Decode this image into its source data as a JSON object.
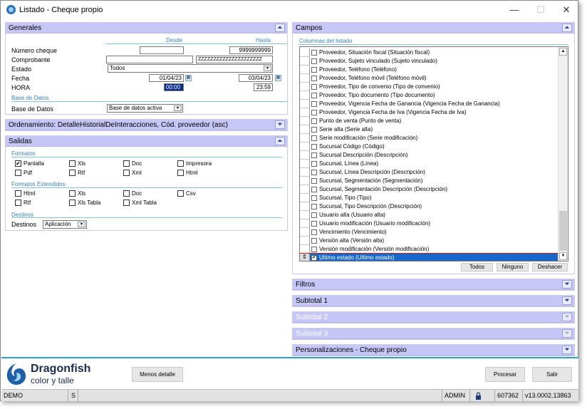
{
  "window": {
    "title": "Listado - Cheque propio",
    "minimize": "—",
    "maximize": "☐",
    "close": "✕"
  },
  "generales": {
    "title": "Generales",
    "desde": "Desde",
    "hasta": "Hasta",
    "numero_cheque_label": "Número cheque",
    "numero_cheque_desde": "",
    "numero_cheque_hasta": "9999999999",
    "comprobante_label": "Comprobante",
    "comprobante_desde": "",
    "comprobante_hasta": "ZZZZZZZZZZZZZZZZZZZZZ",
    "estado_label": "Estado",
    "estado_value": "Todos",
    "fecha_label": "Fecha",
    "fecha_desde": "01/04/23",
    "fecha_hasta": "03/04/23",
    "hora_label": "HORA",
    "hora_desde": "00:00",
    "hora_hasta": "23:59",
    "base_datos_section": "Base de Datos",
    "base_datos_label": "Base de Datos",
    "base_datos_value": "Base de datos activa"
  },
  "ordenamiento": {
    "title": "Ordenamiento: DetalleHistorialDeInteracciones, Cód. proveedor (asc)"
  },
  "salidas": {
    "title": "Salidas",
    "formatos_section": "Formatos",
    "formatos": [
      {
        "label": "Pantalla",
        "checked": true
      },
      {
        "label": "Xls",
        "checked": false
      },
      {
        "label": "Doc",
        "checked": false
      },
      {
        "label": "Impresora",
        "checked": false
      },
      {
        "label": "Pdf",
        "checked": false
      },
      {
        "label": "Rtf",
        "checked": false
      },
      {
        "label": "Xml",
        "checked": false
      },
      {
        "label": "Html",
        "checked": false
      }
    ],
    "extendidos_section": "Formatos Extendidos",
    "extendidos": [
      {
        "label": "Html",
        "checked": false
      },
      {
        "label": "Xls",
        "checked": false
      },
      {
        "label": "Doc",
        "checked": false
      },
      {
        "label": "Csv",
        "checked": false
      },
      {
        "label": "Rtf",
        "checked": false
      },
      {
        "label": "Xls Tabla",
        "checked": false
      },
      {
        "label": "Xml Tabla",
        "checked": false
      }
    ],
    "destinos_section": "Destinos",
    "destinos_label": "Destinos",
    "destinos_value": "Aplicación"
  },
  "campos": {
    "title": "Campos",
    "columnas_label": "Columnas del listado",
    "items": [
      {
        "label": "Proveedor, Situación fiscal (Situación fiscal)",
        "checked": false
      },
      {
        "label": "Proveedor, Sujeto vinculado (Sujeto vinculado)",
        "checked": false
      },
      {
        "label": "Proveedor, Teléfono (Teléfono)",
        "checked": false
      },
      {
        "label": "Proveedor, Teléfono móvil (Teléfono móvil)",
        "checked": false
      },
      {
        "label": "Proveedor, Tipo de convenio (Tipo de convenio)",
        "checked": false
      },
      {
        "label": "Proveedor, Tipo documento (Tipo documento)",
        "checked": false
      },
      {
        "label": "Proveedor, Vigencia Fecha de Ganancia (Vigencia Fecha de Ganancia)",
        "checked": false
      },
      {
        "label": "Proveedor, Vigencia Fecha de Iva (Vigencia Fecha de Iva)",
        "checked": false
      },
      {
        "label": "Punto de venta (Punto de venta)",
        "checked": false
      },
      {
        "label": "Serie alta (Serie alta)",
        "checked": false
      },
      {
        "label": "Serie modificación (Serie modificación)",
        "checked": false
      },
      {
        "label": "Sucursal Código (Código)",
        "checked": false
      },
      {
        "label": "Sucursal Descripción (Descripción)",
        "checked": false
      },
      {
        "label": "Sucursal, Línea (Línea)",
        "checked": false
      },
      {
        "label": "Sucursal, Línea Descripción (Descripción)",
        "checked": false
      },
      {
        "label": "Sucursal, Segmentación (Segmentación)",
        "checked": false
      },
      {
        "label": "Sucursal, Segmentación Descripción (Descripción)",
        "checked": false
      },
      {
        "label": "Sucursal, Tipo (Tipo)",
        "checked": false
      },
      {
        "label": "Sucursal, Tipo Descripción (Descripción)",
        "checked": false
      },
      {
        "label": "Usuario alta (Usuario alta)",
        "checked": false
      },
      {
        "label": "Usuario modificación (Usuario modificación)",
        "checked": false
      },
      {
        "label": "Vencimiento (Vencimiento)",
        "checked": false
      },
      {
        "label": "Versión alta (Versión alta)",
        "checked": false
      },
      {
        "label": "Versión modificación (Versión modificación)",
        "checked": false
      },
      {
        "label": "Ultimo estado (Ultimo estado)",
        "checked": true,
        "selected": true
      }
    ],
    "todos": "Todos",
    "ninguno": "Ninguno",
    "deshacer": "Deshacer"
  },
  "filtros": {
    "title": "Filtros"
  },
  "subtotal1": {
    "title": "Subtotal 1"
  },
  "subtotal2": {
    "title": "Subtotal 2"
  },
  "subtotal3": {
    "title": "Subtotal 3"
  },
  "personalizaciones": {
    "title": "Personalizaciones - Cheque propio"
  },
  "footer": {
    "brand_name": "Dragonfish",
    "brand_tagline": "color y talle",
    "menos_detalle": "Menos detalle",
    "procesar": "Procesar",
    "salir": "Salir"
  },
  "statusbar": {
    "db": "DEMO",
    "mode": "S",
    "user": "ADMIN",
    "lock_icon": "lock-icon",
    "serial": "607362",
    "version": "v13.0002.13863"
  },
  "colors": {
    "panel_header": "#c6c6f7",
    "accent": "#2aa3c9",
    "selection": "#1a66c8"
  }
}
